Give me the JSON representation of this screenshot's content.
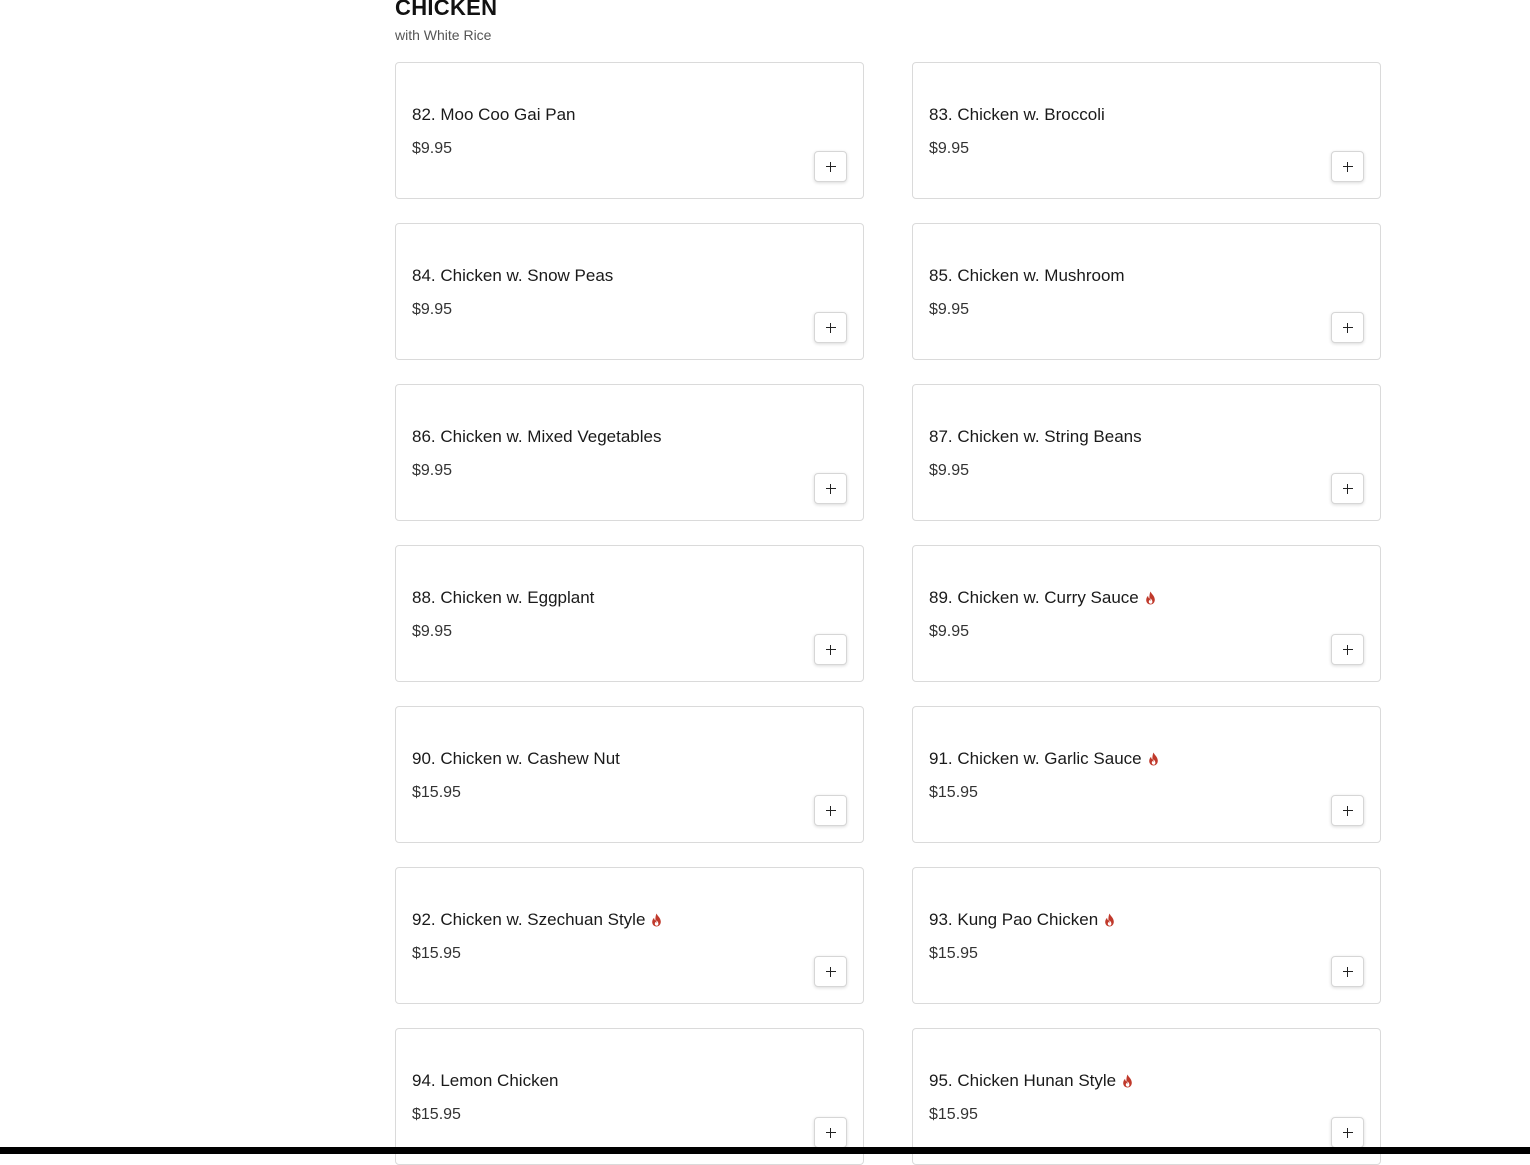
{
  "section": {
    "title": "CHICKEN",
    "subtitle": "with White Rice"
  },
  "colors": {
    "spicy": "#c0392b",
    "card_border": "#dadada",
    "bottom_bar": "#000000"
  },
  "items": [
    {
      "name": "82. Moo Coo Gai Pan",
      "price": "$9.95",
      "spicy": false
    },
    {
      "name": "83. Chicken w. Broccoli",
      "price": "$9.95",
      "spicy": false
    },
    {
      "name": "84. Chicken w. Snow Peas",
      "price": "$9.95",
      "spicy": false
    },
    {
      "name": "85. Chicken w. Mushroom",
      "price": "$9.95",
      "spicy": false
    },
    {
      "name": "86. Chicken w. Mixed Vegetables",
      "price": "$9.95",
      "spicy": false
    },
    {
      "name": "87. Chicken w. String Beans",
      "price": "$9.95",
      "spicy": false
    },
    {
      "name": "88. Chicken w. Eggplant",
      "price": "$9.95",
      "spicy": false
    },
    {
      "name": "89. Chicken w. Curry Sauce",
      "price": "$9.95",
      "spicy": true
    },
    {
      "name": "90. Chicken w. Cashew Nut",
      "price": "$15.95",
      "spicy": false
    },
    {
      "name": "91. Chicken w. Garlic Sauce",
      "price": "$15.95",
      "spicy": true
    },
    {
      "name": "92. Chicken w. Szechuan Style",
      "price": "$15.95",
      "spicy": true
    },
    {
      "name": "93. Kung Pao Chicken",
      "price": "$15.95",
      "spicy": true
    },
    {
      "name": "94. Lemon Chicken",
      "price": "$15.95",
      "spicy": false
    },
    {
      "name": "95. Chicken Hunan Style",
      "price": "$15.95",
      "spicy": true
    }
  ],
  "icons": {
    "add": "plus-icon",
    "spicy": "flame-icon"
  }
}
